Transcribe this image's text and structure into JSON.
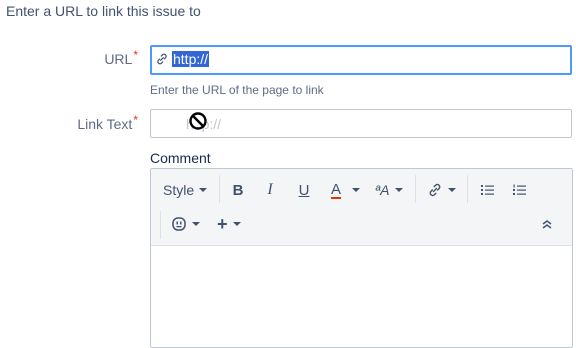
{
  "intro_text": "Enter a URL to link this issue to",
  "url_field": {
    "label": "URL",
    "required_mark": "*",
    "value": "http://",
    "help": "Enter the URL of the page to link"
  },
  "link_text_field": {
    "label": "Link Text",
    "required_mark": "*",
    "placeholder": "http://"
  },
  "comment": {
    "label": "Comment",
    "toolbar": {
      "style_label": "Style",
      "bold": "B",
      "italic": "I",
      "underline": "U",
      "text_color": "A",
      "text_color_swatch": "#de350b",
      "formatting": "ªA",
      "add": "+"
    }
  },
  "icons": [
    "link-icon",
    "not-allowed-cursor-icon",
    "bullet-list-icon",
    "numbered-list-icon",
    "emoji-icon",
    "add-icon",
    "collapse-icon"
  ]
}
